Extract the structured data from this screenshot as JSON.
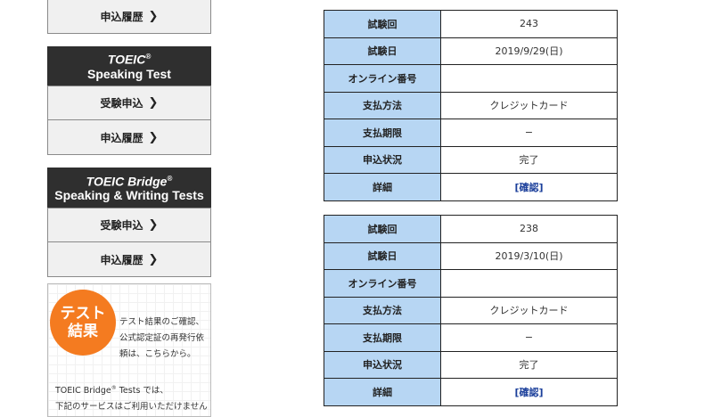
{
  "sidebar": {
    "top_history_label": "申込履歴",
    "chevron": "❯",
    "speaking": {
      "title_line1": "TOEIC",
      "reg_mark": "®",
      "title_line2": "Speaking Test",
      "apply_label": "受験申込",
      "history_label": "申込履歴"
    },
    "bridge": {
      "title_line1": "TOEIC Bridge",
      "reg_mark": "®",
      "title_line2": "Speaking & Writing Tests",
      "apply_label": "受験申込",
      "history_label": "申込履歴"
    },
    "results": {
      "badge_line1": "テスト",
      "badge_line2": "結果",
      "text_line1": "テスト結果のご確認、",
      "text_line2": "公式認定証の再発行依",
      "text_line3": "頼は、こちらから。",
      "note_line1_a": "TOEIC Bridge",
      "note_reg": "®",
      "note_line1_b": " Tests では、",
      "note_line2": "下記のサービスはご利用いただけません"
    }
  },
  "tables": [
    {
      "rows": [
        {
          "label": "試験回",
          "value": "243"
        },
        {
          "label": "試験日",
          "value": "2019/9/29(日)"
        },
        {
          "label": "オンライン番号",
          "value": ""
        },
        {
          "label": "支払方法",
          "value": "クレジットカード"
        },
        {
          "label": "支払期限",
          "value": "−"
        },
        {
          "label": "申込状況",
          "value": "完了"
        },
        {
          "label": "詳細",
          "value": "[確認]"
        }
      ]
    },
    {
      "rows": [
        {
          "label": "試験回",
          "value": "238"
        },
        {
          "label": "試験日",
          "value": "2019/3/10(日)"
        },
        {
          "label": "オンライン番号",
          "value": ""
        },
        {
          "label": "支払方法",
          "value": "クレジットカード"
        },
        {
          "label": "支払期限",
          "value": "−"
        },
        {
          "label": "申込状況",
          "value": "完了"
        },
        {
          "label": "詳細",
          "value": "[確認]"
        }
      ]
    }
  ],
  "colors": {
    "header_bg": "#2f2f2f",
    "key_cell_bg": "#b7d6f3",
    "badge_orange": "#f47b20",
    "link_blue": "#1a3e9a"
  }
}
